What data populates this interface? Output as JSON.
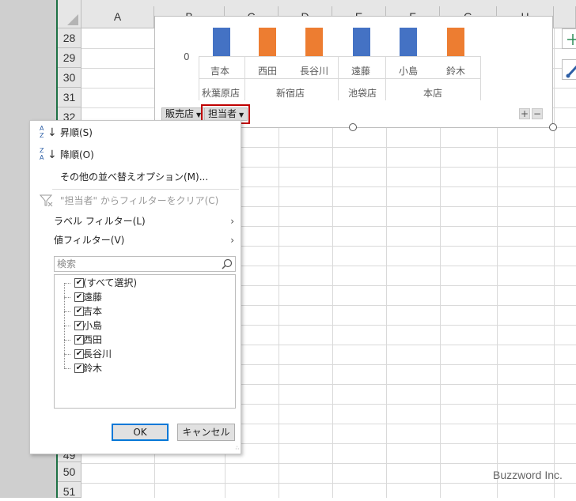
{
  "sheet": {
    "columns": [
      "A",
      "B",
      "C",
      "D",
      "E",
      "F",
      "G",
      "H"
    ],
    "rows_top": [
      "28",
      "29",
      "30",
      "31",
      "32"
    ],
    "rows_bottom": [
      "50",
      "51"
    ],
    "partial_row": "49"
  },
  "chart": {
    "y_zero_label": "0",
    "names": [
      "吉本",
      "西田",
      "長谷川",
      "遠藤",
      "小島",
      "鈴木"
    ],
    "stores": [
      "秋葉原店",
      "新宿店",
      "池袋店",
      "本店"
    ],
    "bar_colors": [
      "#4472c4",
      "#ed7d31",
      "#ed7d31",
      "#4472c4",
      "#4472c4",
      "#ed7d31"
    ],
    "field_buttons": {
      "store": "販売店",
      "person": "担当者"
    },
    "zoom": {
      "plus": "+",
      "minus": "−"
    }
  },
  "menu": {
    "sort_asc": "昇順(S)",
    "sort_desc": "降順(O)",
    "more_sort": "その他の並べ替えオプション(M)...",
    "clear_filter": "\"担当者\" からフィルターをクリア(C)",
    "label_filter": "ラベル フィルター(L)",
    "value_filter": "値フィルター(V)",
    "search_placeholder": "検索",
    "items": [
      "(すべて選択)",
      "遠藤",
      "吉本",
      "小島",
      "西田",
      "長谷川",
      "鈴木"
    ],
    "ok": "OK",
    "cancel": "キャンセル"
  },
  "watermark": "Buzzword Inc."
}
